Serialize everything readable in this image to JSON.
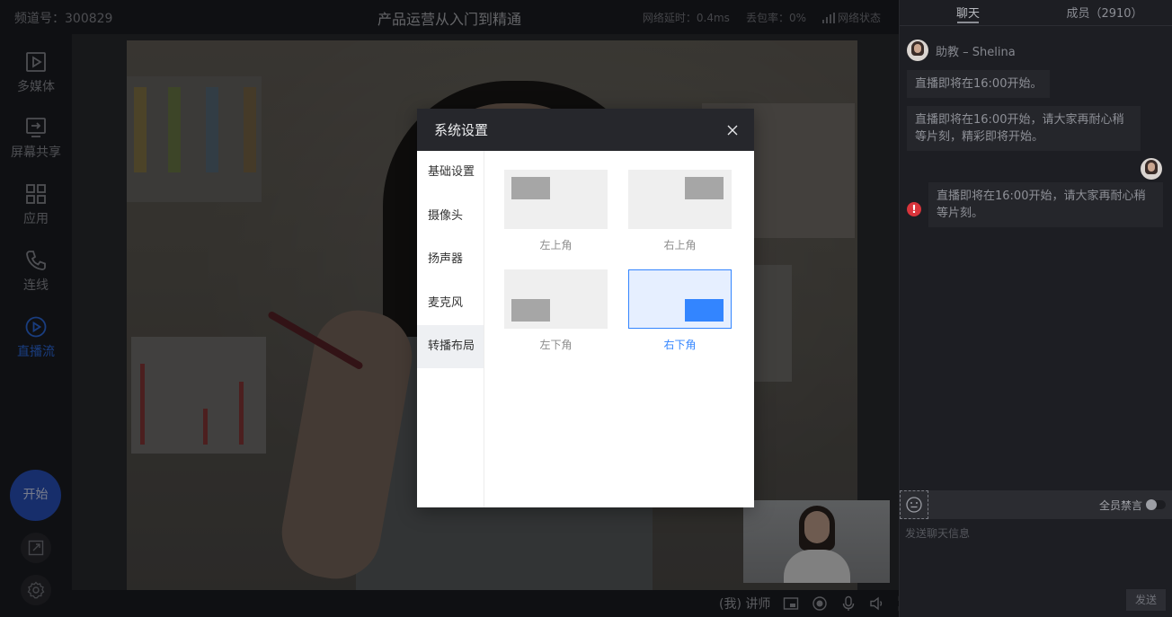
{
  "topbar": {
    "channel": "频道号：300829",
    "course_title": "产品运营从入门到精通",
    "latency": "网络延时：0.4ms",
    "packet_loss": "丢包率：0%",
    "network_status": "网络状态"
  },
  "sidebar": {
    "items": [
      {
        "label": "多媒体",
        "icon": "media-play-icon"
      },
      {
        "label": "屏幕共享",
        "icon": "screen-share-icon"
      },
      {
        "label": "应用",
        "icon": "apps-grid-icon"
      },
      {
        "label": "连线",
        "icon": "phone-icon"
      },
      {
        "label": "直播流",
        "icon": "live-stream-icon",
        "active": true
      }
    ],
    "start_label": "开始"
  },
  "bottombar": {
    "presenter_label": "(我) 讲师"
  },
  "chat": {
    "tabs": [
      {
        "label": "聊天",
        "active": true
      },
      {
        "label": "成员（2910）",
        "active": false
      }
    ],
    "messages": [
      {
        "sender": "助教 – Shelina",
        "text": "直播即将在16:00开始。"
      },
      {
        "text": "直播即将在16:00开始，请大家再耐心稍等片刻，精彩即将开始。"
      },
      {
        "text": "直播即将在16:00开始，请大家再耐心稍等片刻。",
        "failed": true
      }
    ],
    "mute_all_label": "全员禁言",
    "input_placeholder": "发送聊天信息",
    "send_label": "发送"
  },
  "dialog": {
    "title": "系统设置",
    "menu": [
      {
        "label": "基础设置"
      },
      {
        "label": "摄像头"
      },
      {
        "label": "扬声器"
      },
      {
        "label": "麦克风"
      },
      {
        "label": "转播布局",
        "active": true
      }
    ],
    "layouts": [
      {
        "label": "左上角",
        "selected": false
      },
      {
        "label": "右上角",
        "selected": false
      },
      {
        "label": "左下角",
        "selected": false
      },
      {
        "label": "右下角",
        "selected": true
      }
    ]
  },
  "colors": {
    "accent": "#3385ff",
    "sidebar_active": "#2f6fe8",
    "start_button": "#2a55c4",
    "error": "#d8343b",
    "dialog_header": "#26272c"
  }
}
